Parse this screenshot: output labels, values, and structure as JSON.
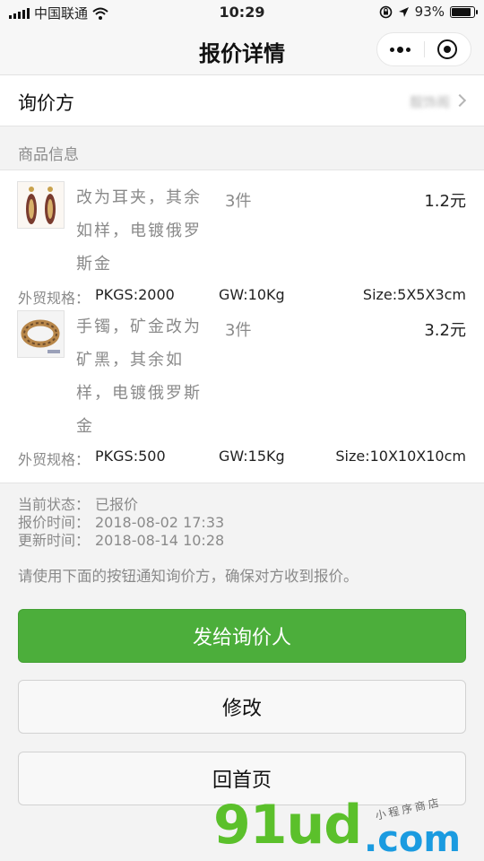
{
  "status_bar": {
    "carrier": "中国联通",
    "time": "10:29",
    "battery": "93%",
    "battery_level": 0.93
  },
  "nav": {
    "title": "报价详情"
  },
  "inquirer": {
    "label": "询价方",
    "value": "靓饰阁"
  },
  "goods_section": {
    "title": "商品信息",
    "spec_label": "外贸规格：",
    "items": [
      {
        "desc": "改为耳夹，其余如样，电镀俄罗斯金",
        "qty": "3件",
        "price": "1.2元",
        "pkgs": "PKGS:2000",
        "gw": "GW:10Kg",
        "size": "Size:5X5X3cm"
      },
      {
        "desc": "手镯，矿金改为矿黑，其余如样，电镀俄罗斯金",
        "qty": "3件",
        "price": "3.2元",
        "pkgs": "PKGS:500",
        "gw": "GW:15Kg",
        "size": "Size:10X10X10cm"
      }
    ]
  },
  "status_info": {
    "state_label": "当前状态：",
    "state_value": "已报价",
    "quote_time_label": "报价时间：",
    "quote_time_value": "2018-08-02 17:33",
    "update_time_label": "更新时间：",
    "update_time_value": "2018-08-14 10:28"
  },
  "notice": "请使用下面的按钮通知询价方，确保对方收到报价。",
  "buttons": {
    "send": "发给询价人",
    "edit": "修改",
    "home": "回首页"
  },
  "watermark": {
    "main": "91ud",
    "suffix": ".com",
    "sub": "小程序商店"
  },
  "colors": {
    "primary_green": "#4cae3b",
    "watermark_green": "#5bc02b",
    "watermark_blue": "#1b9be0"
  }
}
